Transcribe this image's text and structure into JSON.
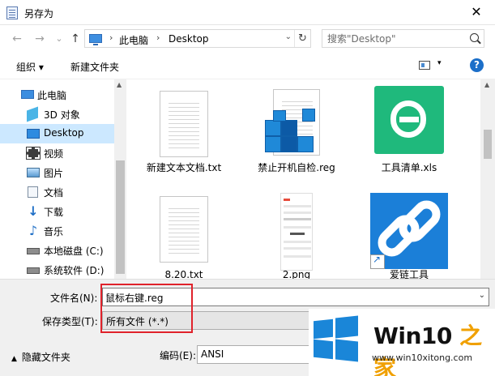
{
  "window": {
    "title": "另存为",
    "close_glyph": "✕"
  },
  "address": {
    "back_glyph": "←",
    "forward_glyph": "→",
    "recent_glyph": "⌄",
    "up_glyph": "↑",
    "breadcrumb": [
      "此电脑",
      "Desktop"
    ],
    "separator": "›",
    "dropdown_glyph": "⌄",
    "refresh_glyph": "↻",
    "search_placeholder": "搜索\"Desktop\""
  },
  "toolbar": {
    "organize_label": "组织 ▾",
    "new_folder_label": "新建文件夹",
    "view_dropdown_glyph": "▾",
    "help_label": "?"
  },
  "sidebar": {
    "items": [
      {
        "label": "此电脑",
        "icon": "computer-icon",
        "level": 1,
        "selected": false
      },
      {
        "label": "3D 对象",
        "icon": "3d-objects-icon",
        "level": 2,
        "selected": false
      },
      {
        "label": "Desktop",
        "icon": "desktop-icon",
        "level": 2,
        "selected": true
      },
      {
        "label": "视频",
        "icon": "video-icon",
        "level": 2,
        "selected": false
      },
      {
        "label": "图片",
        "icon": "pictures-icon",
        "level": 2,
        "selected": false
      },
      {
        "label": "文档",
        "icon": "documents-icon",
        "level": 2,
        "selected": false
      },
      {
        "label": "下载",
        "icon": "download-icon",
        "level": 2,
        "selected": false
      },
      {
        "label": "音乐",
        "icon": "music-icon",
        "level": 2,
        "selected": false
      },
      {
        "label": "本地磁盘 (C:)",
        "icon": "local-disk-icon",
        "level": 2,
        "selected": false
      },
      {
        "label": "系统软件 (D:)",
        "icon": "drive-icon",
        "level": 2,
        "selected": false
      }
    ],
    "scroll_up_glyph": "▲"
  },
  "files": {
    "items": [
      {
        "name": "新建文本文档.txt",
        "icon": "text-file-icon"
      },
      {
        "name": "禁止开机自检.reg",
        "icon": "registry-file-icon"
      },
      {
        "name": "工具清单.xls",
        "icon": "spreadsheet-icon"
      },
      {
        "name": "8.20.txt",
        "icon": "text-file-icon"
      },
      {
        "name": "2.png",
        "icon": "image-file-icon"
      },
      {
        "name": "爱链工具",
        "icon": "link-shortcut-icon"
      }
    ],
    "scroll_up_glyph": "▲"
  },
  "form": {
    "filename_label": "文件名(N):",
    "filename_value": "鼠标右键.reg",
    "filename_dropdown_glyph": "⌄",
    "filetype_label": "保存类型(T):",
    "filetype_value": "所有文件  (*.*)"
  },
  "bottom": {
    "hide_folders_label": "隐藏文件夹",
    "hide_folders_caret": "▲",
    "encoding_label": "编码(E):",
    "encoding_value": "ANSI"
  },
  "watermark": {
    "brand_prefix": "Win10",
    "brand_suffix": " 之家",
    "url": "www.win10xitong.com"
  },
  "colors": {
    "selection": "#cce8ff",
    "accent_blue": "#1c6fc9",
    "highlight_red": "#e0222b",
    "spreadsheet_green": "#1fb97c",
    "watermark_accent": "#f0a000"
  }
}
